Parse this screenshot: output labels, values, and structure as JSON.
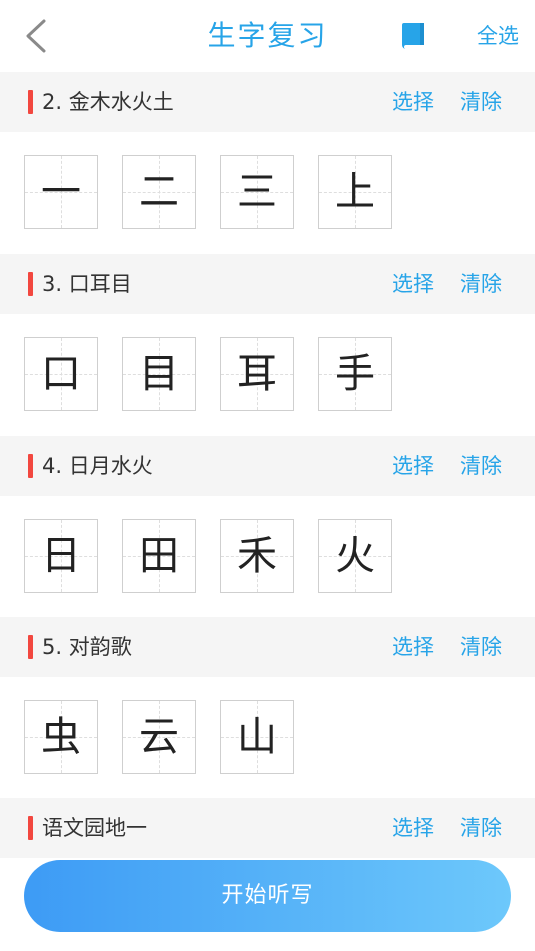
{
  "header": {
    "title": "生字复习",
    "select_all": "全选"
  },
  "sections": [
    {
      "title": "2. 金木水火土",
      "select": "选择",
      "clear": "清除",
      "chars": [
        "一",
        "二",
        "三",
        "上"
      ]
    },
    {
      "title": "3. 口耳目",
      "select": "选择",
      "clear": "清除",
      "chars": [
        "口",
        "目",
        "耳",
        "手"
      ]
    },
    {
      "title": "4. 日月水火",
      "select": "选择",
      "clear": "清除",
      "chars": [
        "日",
        "田",
        "禾",
        "火"
      ]
    },
    {
      "title": "5. 对韵歌",
      "select": "选择",
      "clear": "清除",
      "chars": [
        "虫",
        "云",
        "山"
      ]
    },
    {
      "title": "语文园地一",
      "select": "选择",
      "clear": "清除",
      "chars": []
    }
  ],
  "footer": {
    "start_label": "开始听写"
  },
  "colors": {
    "accent": "#27a4e8",
    "section_marker": "#f2473f",
    "section_bg": "#f5f5f5",
    "button_gradient_start": "#3d9bf5",
    "button_gradient_end": "#6dc8fb"
  },
  "icons": {
    "back": "chevron-left-icon",
    "book": "book-icon"
  }
}
